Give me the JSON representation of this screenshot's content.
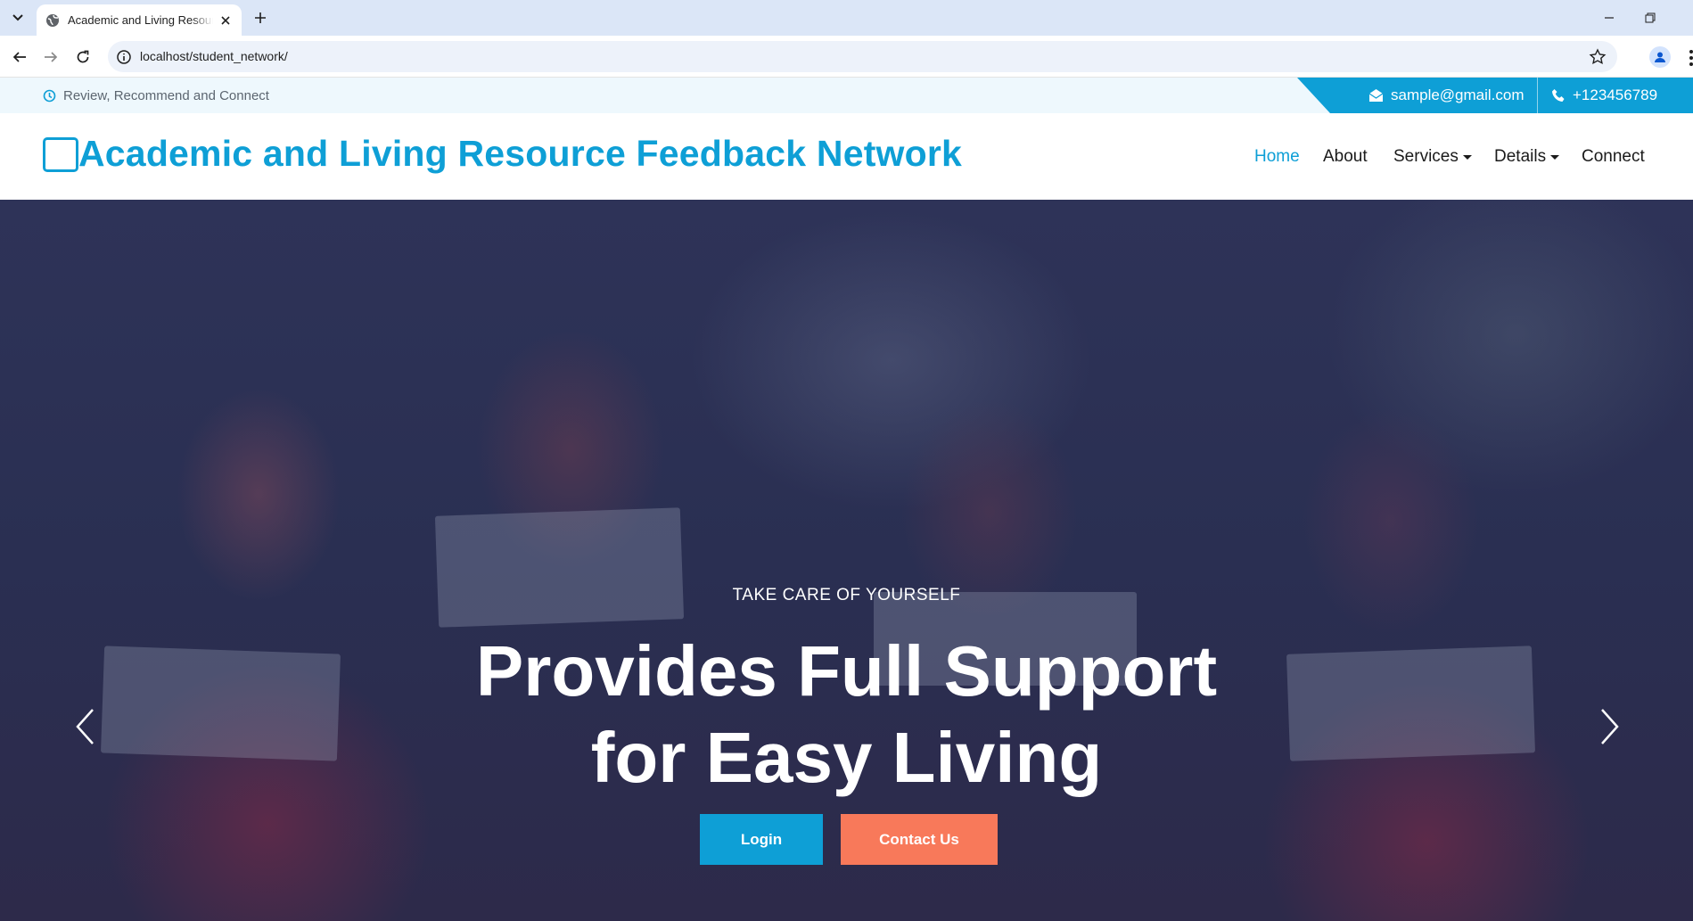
{
  "browser": {
    "tab_title": "Academic and Living Resource Feedback Network",
    "url": "localhost/student_network/"
  },
  "topbar": {
    "tagline": "Review, Recommend and Connect",
    "email": "sample@gmail.com",
    "phone": "+123456789"
  },
  "header": {
    "site_title": "Academic and Living Resource Feedback Network",
    "nav": [
      {
        "label": "Home",
        "active": true
      },
      {
        "label": "About"
      },
      {
        "label": "Services",
        "dropdown": true
      },
      {
        "label": "Details",
        "dropdown": true
      },
      {
        "label": "Connect"
      }
    ]
  },
  "hero": {
    "subtitle": "TAKE CARE OF YOURSELF",
    "title_line1": "Provides Full Support",
    "title_line2": "for Easy Living",
    "login_label": "Login",
    "contact_label": "Contact Us"
  },
  "colors": {
    "accent": "#0e9fd6",
    "secondary": "#f8795a"
  }
}
